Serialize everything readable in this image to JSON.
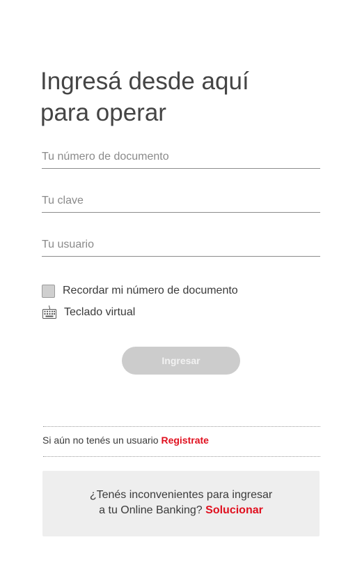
{
  "title": {
    "line1": "Ingresá desde aquí",
    "line2": "para operar"
  },
  "form": {
    "document_placeholder": "Tu número de documento",
    "password_placeholder": "Tu clave",
    "user_placeholder": "Tu usuario",
    "remember_label": "Recordar mi número de documento",
    "remember_checked": false,
    "virtual_keyboard_label": "Teclado virtual",
    "submit_label": "Ingresar"
  },
  "register": {
    "text": "Si aún no tenés un usuario",
    "link": "Registrate"
  },
  "help": {
    "line1": "¿Tenés inconvenientes para ingresar",
    "line2_text": "a tu Online Banking?",
    "link": "Solucionar"
  },
  "icons": {
    "keyboard": "keyboard-icon",
    "checkbox": "checkbox"
  },
  "colors": {
    "accent": "#e0101f",
    "button_disabled": "#cccccc",
    "help_background": "#eeeeee"
  }
}
